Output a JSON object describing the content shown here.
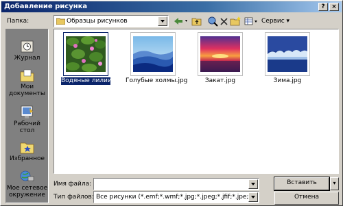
{
  "window": {
    "title": "Добавление рисунка",
    "help_button": "?",
    "close_button": "×"
  },
  "folder": {
    "label": "Папка:",
    "value": "Образцы рисунков"
  },
  "toolbar": {
    "service_label": "Сервис"
  },
  "sidebar": {
    "items": [
      {
        "label": "Журнал",
        "icon": "history-icon"
      },
      {
        "label": "Мои документы",
        "icon": "my-documents-icon"
      },
      {
        "label": "Рабочий стол",
        "icon": "desktop-icon"
      },
      {
        "label": "Избранное",
        "icon": "favorites-icon"
      },
      {
        "label": "Мое сетевое окружение",
        "icon": "network-icon"
      }
    ]
  },
  "files": [
    {
      "name": "Водяные лилии.jpg",
      "selected": true
    },
    {
      "name": "Голубые холмы.jpg",
      "selected": false
    },
    {
      "name": "Закат.jpg",
      "selected": false
    },
    {
      "name": "Зима.jpg",
      "selected": false
    }
  ],
  "filename": {
    "label": "Имя файла:",
    "value": ""
  },
  "filetype": {
    "label": "Тип файлов:",
    "value": "Все рисунки (*.emf;*.wmf;*.jpg;*.jpeg;*.jfif;*.jpe;*.png;*"
  },
  "buttons": {
    "insert": "Вставить",
    "cancel": "Отмена"
  },
  "colors": {
    "title_active": "#0a246a",
    "selection": "#0a246a",
    "face": "#d4d0c8"
  }
}
